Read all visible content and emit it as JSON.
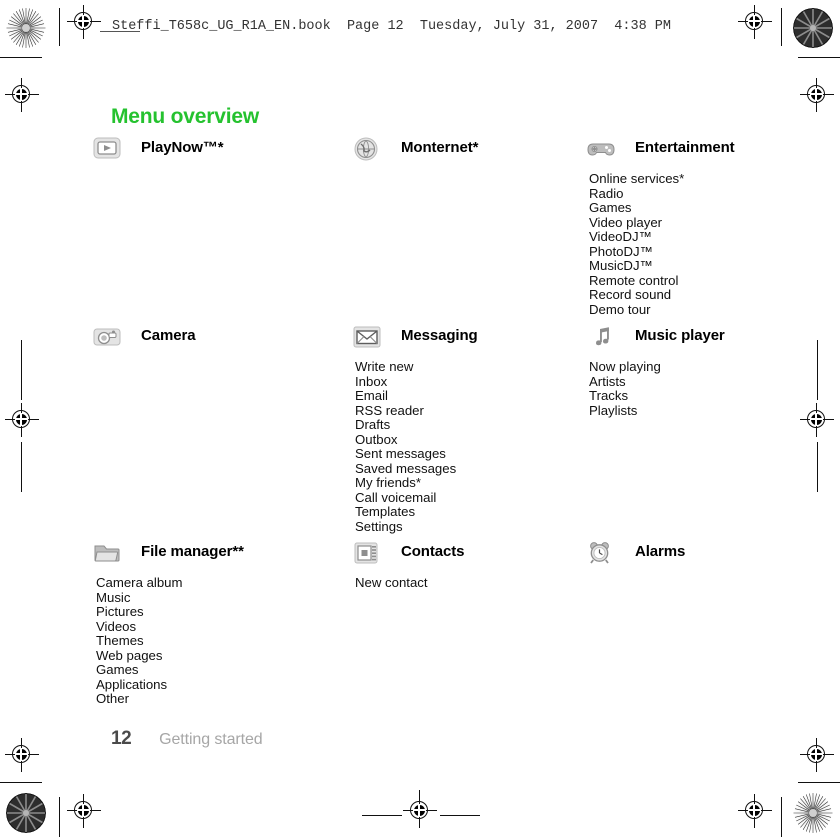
{
  "document": {
    "header_line": "Steffi_T658c_UG_R1A_EN.book  Page 12  Tuesday, July 31, 2007  4:38 PM",
    "title": "Menu overview",
    "title_color": "#25c22f",
    "footer": {
      "page_number": "12",
      "section": "Getting started"
    }
  },
  "menu": {
    "blocks": [
      {
        "title": "PlayNow™*",
        "icon": "playnow-icon",
        "column": 1,
        "row": 1,
        "items": []
      },
      {
        "title": "Monternet*",
        "icon": "globe-icon",
        "column": 2,
        "row": 1,
        "items": []
      },
      {
        "title": "Entertainment",
        "icon": "gamepad-icon",
        "column": 3,
        "row": 1,
        "items": [
          "Online services*",
          "Radio",
          "Games",
          "Video player",
          "VideoDJ™",
          "PhotoDJ™",
          "MusicDJ™",
          "Remote control",
          "Record sound",
          "Demo tour"
        ]
      },
      {
        "title": "Camera",
        "icon": "camera-icon",
        "column": 1,
        "row": 2,
        "items": []
      },
      {
        "title": "Messaging",
        "icon": "envelope-icon",
        "column": 2,
        "row": 2,
        "items": [
          "Write new",
          "Inbox",
          "Email",
          "RSS reader",
          "Drafts",
          "Outbox",
          "Sent messages",
          "Saved messages",
          "My friends*",
          "Call voicemail",
          "Templates",
          "Settings"
        ]
      },
      {
        "title": "Music player",
        "icon": "music-note-icon",
        "column": 3,
        "row": 2,
        "items": [
          "Now playing",
          "Artists",
          "Tracks",
          "Playlists"
        ]
      },
      {
        "title": "File manager**",
        "icon": "folder-icon",
        "column": 1,
        "row": 3,
        "items": [
          "Camera album",
          "Music",
          "Pictures",
          "Videos",
          "Themes",
          "Web pages",
          "Games",
          "Applications",
          "Other"
        ]
      },
      {
        "title": "Contacts",
        "icon": "contacts-icon",
        "column": 2,
        "row": 3,
        "items": [
          "New contact"
        ]
      },
      {
        "title": "Alarms",
        "icon": "alarm-clock-icon",
        "column": 3,
        "row": 3,
        "items": []
      }
    ]
  }
}
